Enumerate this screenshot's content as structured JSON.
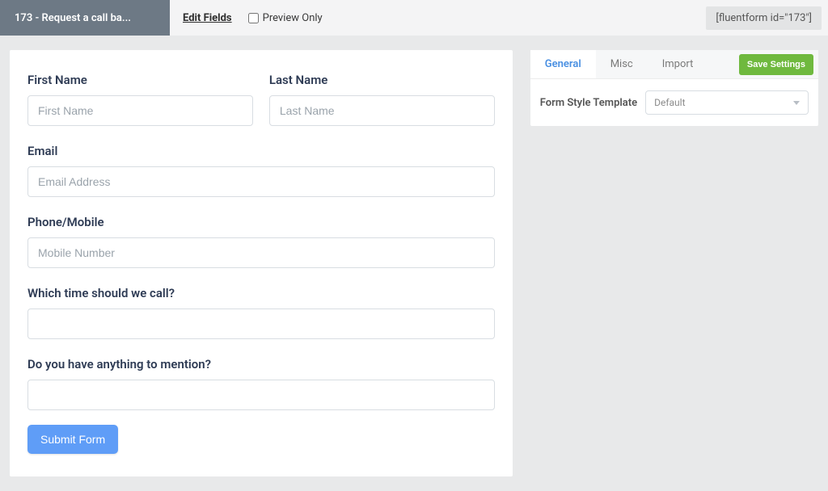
{
  "topbar": {
    "form_title": "173 - Request a call ba...",
    "edit_fields": "Edit Fields",
    "preview_only_label": "Preview Only",
    "shortcode": "[fluentform id=\"173\"]"
  },
  "form": {
    "fields": {
      "first_name": {
        "label": "First Name",
        "placeholder": "First Name"
      },
      "last_name": {
        "label": "Last Name",
        "placeholder": "Last Name"
      },
      "email": {
        "label": "Email",
        "placeholder": "Email Address"
      },
      "phone": {
        "label": "Phone/Mobile",
        "placeholder": "Mobile Number"
      },
      "call_time": {
        "label": "Which time should we call?",
        "placeholder": ""
      },
      "message": {
        "label": "Do you have anything to mention?",
        "placeholder": ""
      }
    },
    "submit_label": "Submit Form"
  },
  "sidebar": {
    "tabs": {
      "general": "General",
      "misc": "Misc",
      "import": "Import"
    },
    "save_label": "Save Settings",
    "style_template_label": "Form Style Template",
    "style_template_value": "Default"
  }
}
